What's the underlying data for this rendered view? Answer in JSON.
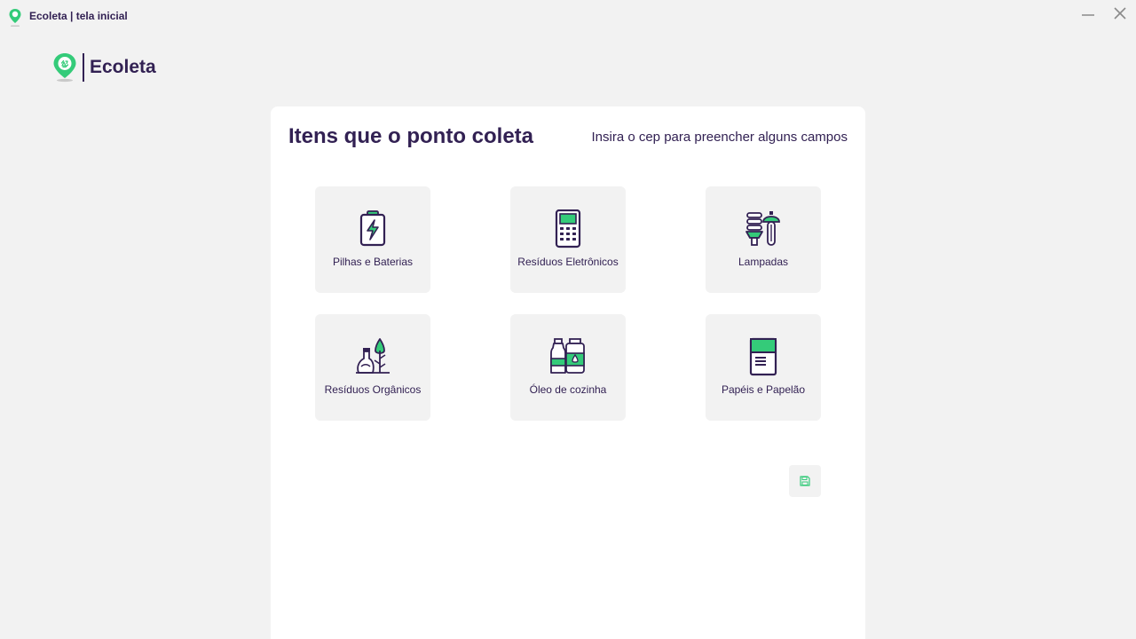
{
  "window": {
    "title": "Ecoleta | tela inicial",
    "icon": "ecoleta-pin-icon"
  },
  "logo": {
    "text": "Ecoleta",
    "icon": "recycle-pin-icon"
  },
  "card": {
    "heading": "Itens que o ponto coleta",
    "subheading": "Insira o cep para preencher alguns campos"
  },
  "items": [
    {
      "label": "Pilhas e Baterias",
      "icon": "battery-icon"
    },
    {
      "label": "Resíduos Eletrônicos",
      "icon": "electronics-icon"
    },
    {
      "label": "Lampadas",
      "icon": "lamps-icon"
    },
    {
      "label": "Resíduos Orgânicos",
      "icon": "organic-waste-icon"
    },
    {
      "label": "Óleo de cozinha",
      "icon": "cooking-oil-icon"
    },
    {
      "label": "Papéis e Papelão",
      "icon": "paper-icon"
    }
  ],
  "save_button": {
    "icon": "save-icon"
  },
  "colors": {
    "primary": "#322153",
    "accent": "#34cb79",
    "background": "#f2f2f2",
    "card": "#ffffff"
  }
}
